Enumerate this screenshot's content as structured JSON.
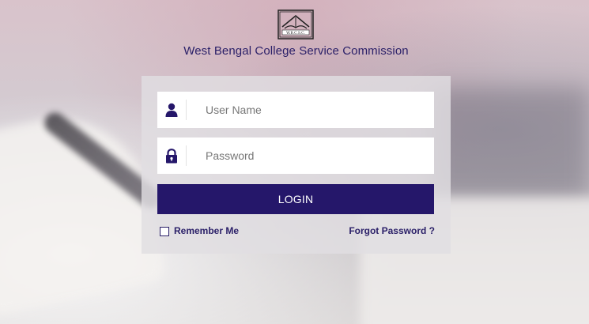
{
  "branding": {
    "logo_text": "W.B.C.S.C.",
    "title": "West Bengal College Service Commission",
    "brand_color": "#25176a"
  },
  "login_form": {
    "username": {
      "icon": "user-icon",
      "placeholder": "User Name",
      "value": ""
    },
    "password": {
      "icon": "lock-icon",
      "placeholder": "Password",
      "value": ""
    },
    "login_label": "LOGIN",
    "remember_label": "Remember Me",
    "remember_checked": false,
    "forgot_label": "Forgot Password ?"
  }
}
